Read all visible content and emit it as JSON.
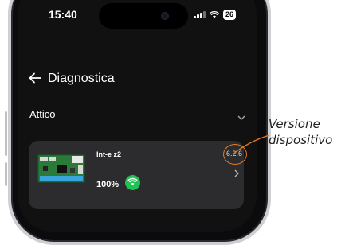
{
  "status_bar": {
    "time": "15:40",
    "battery": "26"
  },
  "header": {
    "back_icon": "arrow-left-icon",
    "title": "Diagnostica"
  },
  "section": {
    "label": "Attico",
    "chevron_icon": "chevron-down-icon"
  },
  "device": {
    "name": "Int-e z2",
    "battery_percent": "100%",
    "version": "6.2.6",
    "signal_icon": "wifi-icon",
    "chevron_icon": "chevron-right-icon"
  },
  "annotation": {
    "line1": "Versione",
    "line2": "dispositivo"
  },
  "colors": {
    "screen_bg": "#111112",
    "card_bg": "#2c2c2e",
    "wifi_green": "#20c253",
    "callout_orange": "#e87a20"
  }
}
